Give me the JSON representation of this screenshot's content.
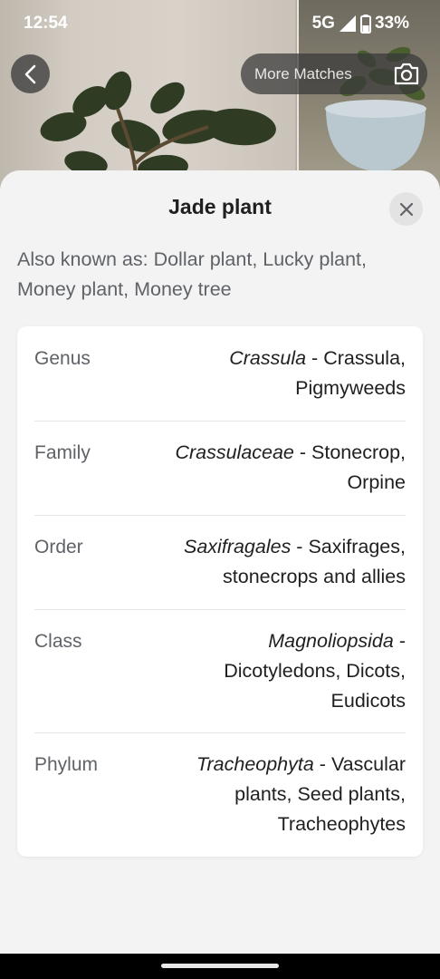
{
  "status_bar": {
    "time": "12:54",
    "network": "5G",
    "battery": "33%"
  },
  "header": {
    "more_matches_label": "More Matches",
    "back_icon": "chevron-left-icon",
    "camera_icon": "camera-icon"
  },
  "sheet": {
    "title": "Jade plant",
    "also_known_as": "Also known as: Dollar plant, Lucky plant, Money plant, Money tree",
    "close_icon": "close-icon",
    "taxonomy": [
      {
        "rank": "Genus",
        "scientific": "Crassula",
        "common": "Crassula, Pigmyweeds"
      },
      {
        "rank": "Family",
        "scientific": "Crassulaceae",
        "common": "Stonecrop, Orpine"
      },
      {
        "rank": "Order",
        "scientific": "Saxifragales",
        "common": "Saxifrages, stonecrops and allies"
      },
      {
        "rank": "Class",
        "scientific": "Magnoliopsida",
        "common": "Dicotyledons, Dicots, Eudicots"
      },
      {
        "rank": "Phylum",
        "scientific": "Tracheophyta",
        "common": "Vascular plants, Seed plants, Tracheophytes"
      }
    ]
  },
  "colors": {
    "sheet_bg": "#f3f3f3",
    "card_bg": "#ffffff",
    "secondary_text": "#5f6368",
    "primary_text": "#1f1f1f"
  }
}
